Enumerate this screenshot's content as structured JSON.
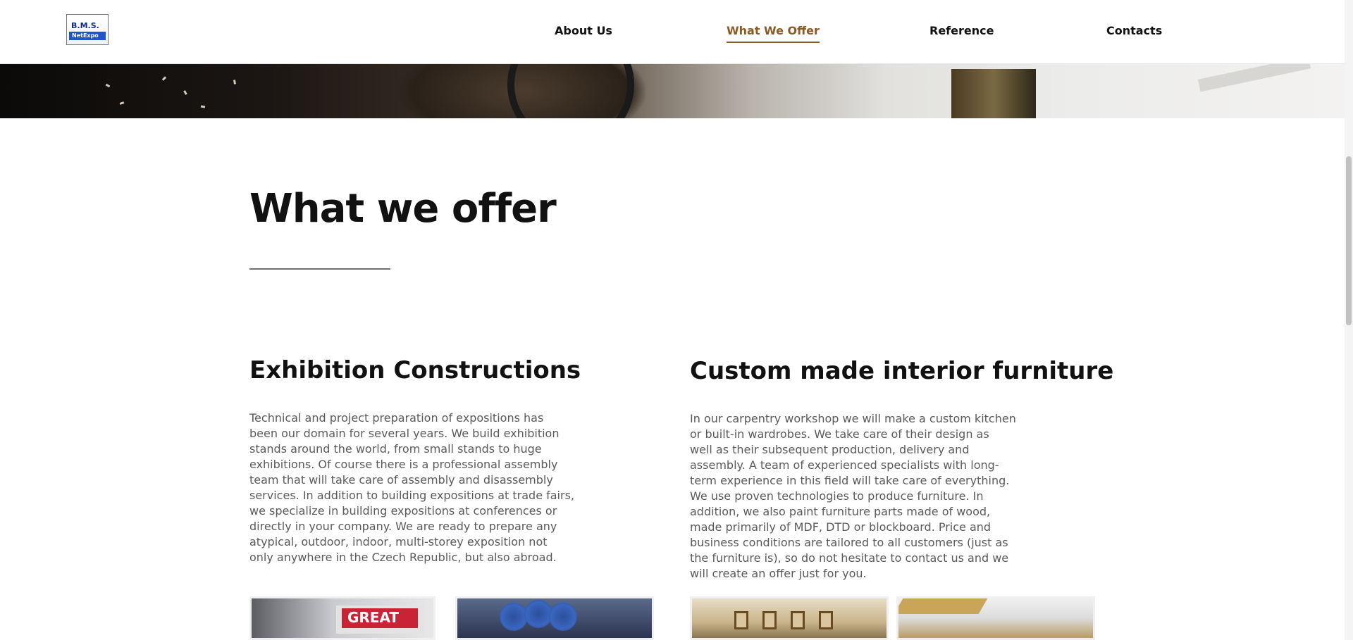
{
  "nav": {
    "logo": {
      "line1": "B.M.S.",
      "line2": "NetExpo"
    },
    "items": [
      {
        "label": "About Us",
        "active": false
      },
      {
        "label": "What We Offer",
        "active": true
      },
      {
        "label": "Reference",
        "active": false
      },
      {
        "label": "Contacts",
        "active": false
      }
    ],
    "colors": {
      "active": "#8b5a23",
      "text": "#111111"
    }
  },
  "main": {
    "title": "What we offer",
    "sections": [
      {
        "heading": "Exhibition Constructions",
        "lines": [
          "Technical and project preparation of expositions has",
          "been our domain for several years. We build exhibition",
          "stands around the world, from small stands to huge",
          "exhibitions. Of course there is a professional assembly",
          "team that will take care of assembly and disassembly",
          "services. In addition to building expositions at trade fairs,",
          "we specialize in building expositions at conferences or",
          "directly in your company. We are ready to prepare any",
          "atypical, outdoor, indoor, multi-storey exposition not",
          "only anywhere in the Czech Republic, but also abroad."
        ],
        "image_text": "GREAT"
      },
      {
        "heading": "Custom made interior furniture",
        "lines": [
          "In our carpentry workshop we will make a custom kitchen",
          "or built-in wardrobes. We take care of their design as",
          "well as their subsequent production, delivery and",
          "assembly. A team of experienced specialists with long-",
          "term experience in this field will take care of everything.",
          "We use proven technologies to produce furniture. In",
          "addition, we also paint furniture parts made of wood,",
          "made primarily of MDF, DTD or blockboard. Price and",
          "business conditions are tailored to all customers (just as",
          "the furniture is), so do not hesitate to contact us and we",
          "will create an offer just for you."
        ]
      }
    ]
  }
}
